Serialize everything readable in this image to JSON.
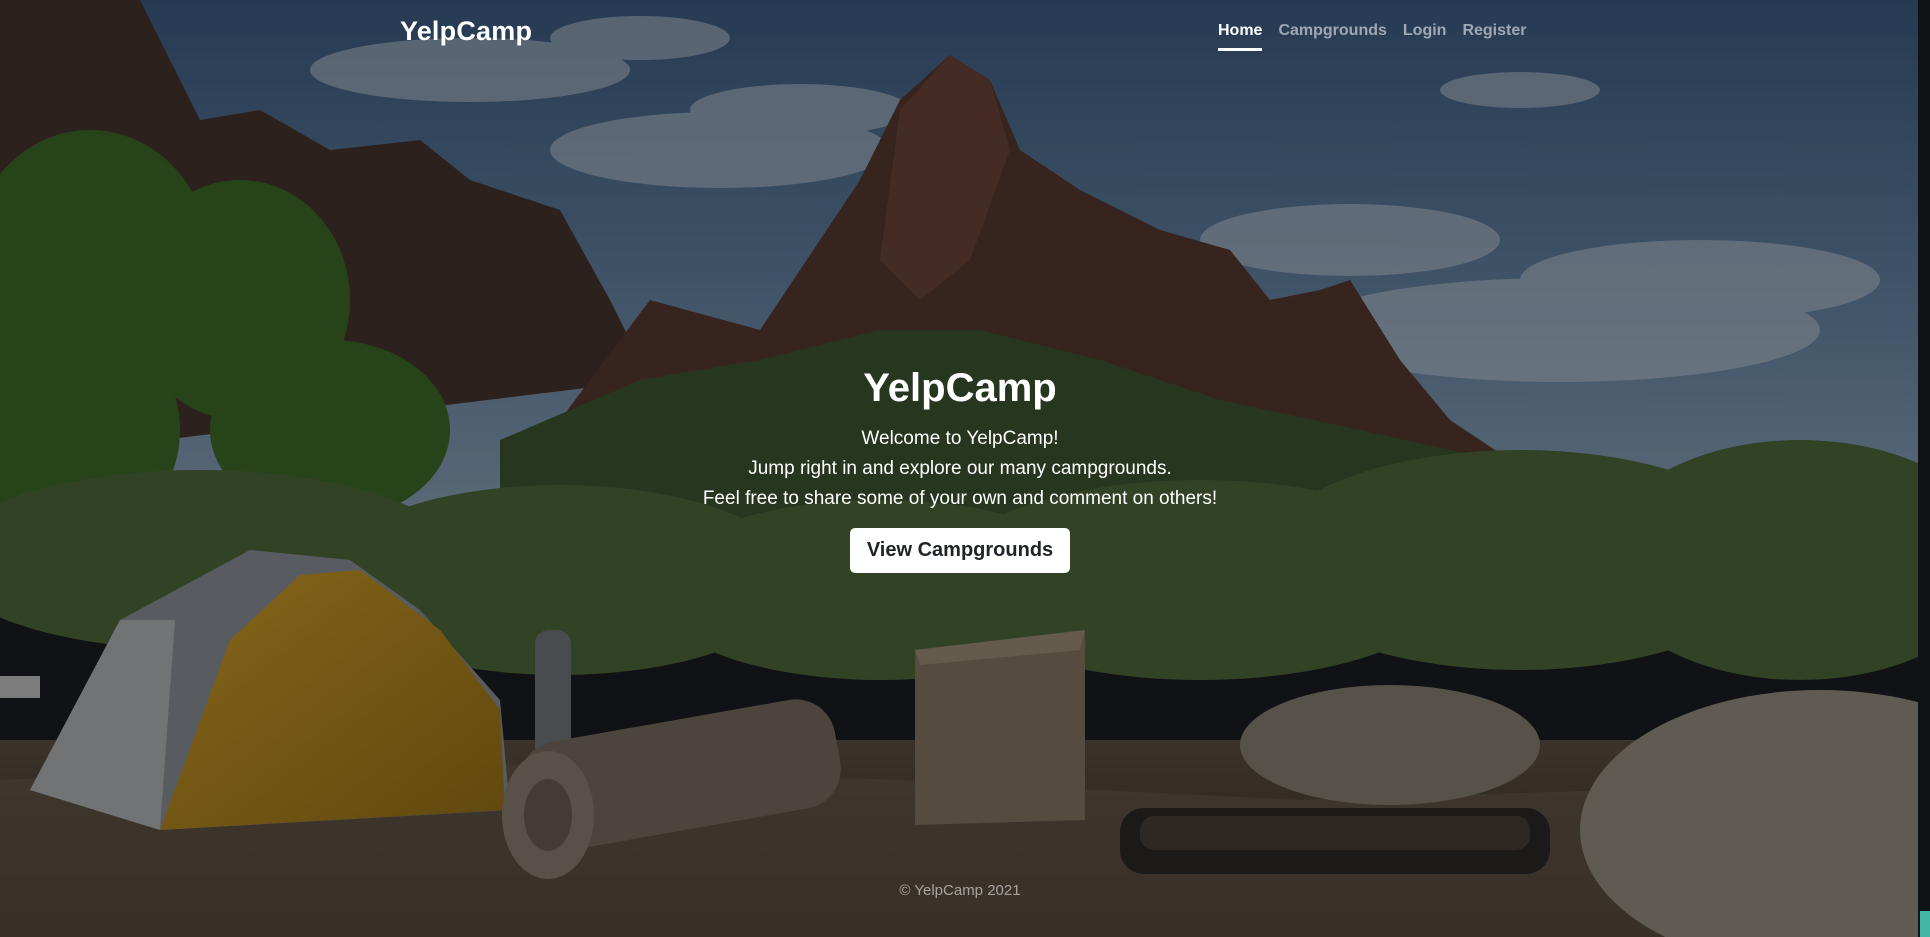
{
  "navbar": {
    "brand": "YelpCamp",
    "links": [
      {
        "label": "Home",
        "active": true
      },
      {
        "label": "Campgrounds",
        "active": false
      },
      {
        "label": "Login",
        "active": false
      },
      {
        "label": "Register",
        "active": false
      }
    ]
  },
  "hero": {
    "title": "YelpCamp",
    "lines": [
      "Welcome to YelpCamp!",
      "Jump right in and explore our many campgrounds.",
      "Feel free to share some of your own and comment on others!"
    ],
    "button_label": "View Campgrounds"
  },
  "footer": {
    "text": "© YelpCamp 2021"
  },
  "colors": {
    "primary_text": "#ffffff",
    "muted_link": "#9a9c9f",
    "button_bg": "#ffffff",
    "button_text": "#212529",
    "scroll_accent": "#3fb8a6"
  }
}
